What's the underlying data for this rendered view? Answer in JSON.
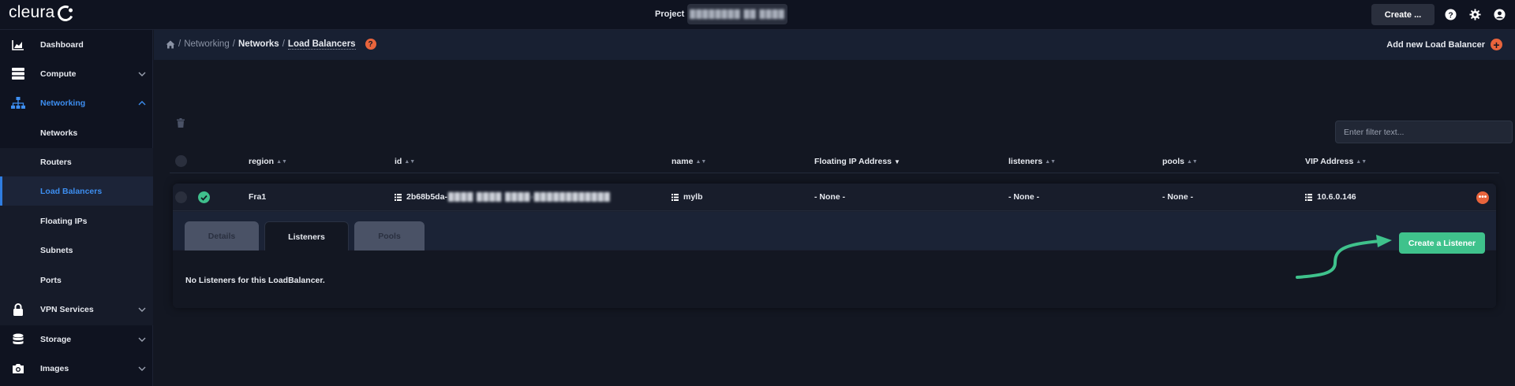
{
  "brand": {
    "name": "cleura",
    "logo_icon": "cleura-c-icon"
  },
  "topbar": {
    "project_label": "Project",
    "project_value": "████████ ██ ████",
    "create_label": "Create ...",
    "icons": [
      "help-icon",
      "settings-gear-icon",
      "user-account-icon"
    ]
  },
  "sidebar": {
    "items": [
      {
        "label": "Dashboard",
        "icon": "chart-area-icon"
      },
      {
        "label": "Compute",
        "icon": "server-icon",
        "expandable": true
      },
      {
        "label": "Networking",
        "icon": "network-sitemap-icon",
        "expandable": true,
        "expanded": true
      },
      {
        "label": "Networks"
      },
      {
        "label": "Routers"
      },
      {
        "label": "Load Balancers",
        "active": true
      },
      {
        "label": "Floating IPs"
      },
      {
        "label": "Subnets"
      },
      {
        "label": "Ports"
      },
      {
        "label": "VPN Services",
        "icon": "lock-icon",
        "expandable": true
      },
      {
        "label": "Storage",
        "icon": "database-icon",
        "expandable": true
      },
      {
        "label": "Images",
        "icon": "camera-icon",
        "expandable": true
      }
    ]
  },
  "breadcrumb": {
    "items": [
      "Networking",
      "Networks",
      "Load Balancers"
    ],
    "add_new_label": "Add new Load Balancer"
  },
  "table": {
    "filter_placeholder": "Enter filter text...",
    "columns": [
      "region",
      "id",
      "name",
      "Floating IP Address",
      "listeners",
      "pools",
      "VIP Address"
    ],
    "sorted_column": "Floating IP Address",
    "rows": [
      {
        "status": "active",
        "region": "Fra1",
        "id_visible": "2b68b5da-",
        "id_redacted": "████ ████ ████-████████████",
        "name": "mylb",
        "floating_ip": "- None -",
        "listeners": "- None -",
        "pools": "- None -",
        "vip_address": "10.6.0.146"
      }
    ]
  },
  "detail": {
    "tabs": [
      "Details",
      "Listeners",
      "Pools"
    ],
    "active_tab": "Listeners",
    "empty_message": "No Listeners for this LoadBalancer.",
    "create_button_label": "Create a Listener"
  },
  "colors": {
    "accent_blue": "#3d8ef0",
    "accent_orange": "#e8643c",
    "success_green": "#3fc28c",
    "background": "#131722"
  }
}
